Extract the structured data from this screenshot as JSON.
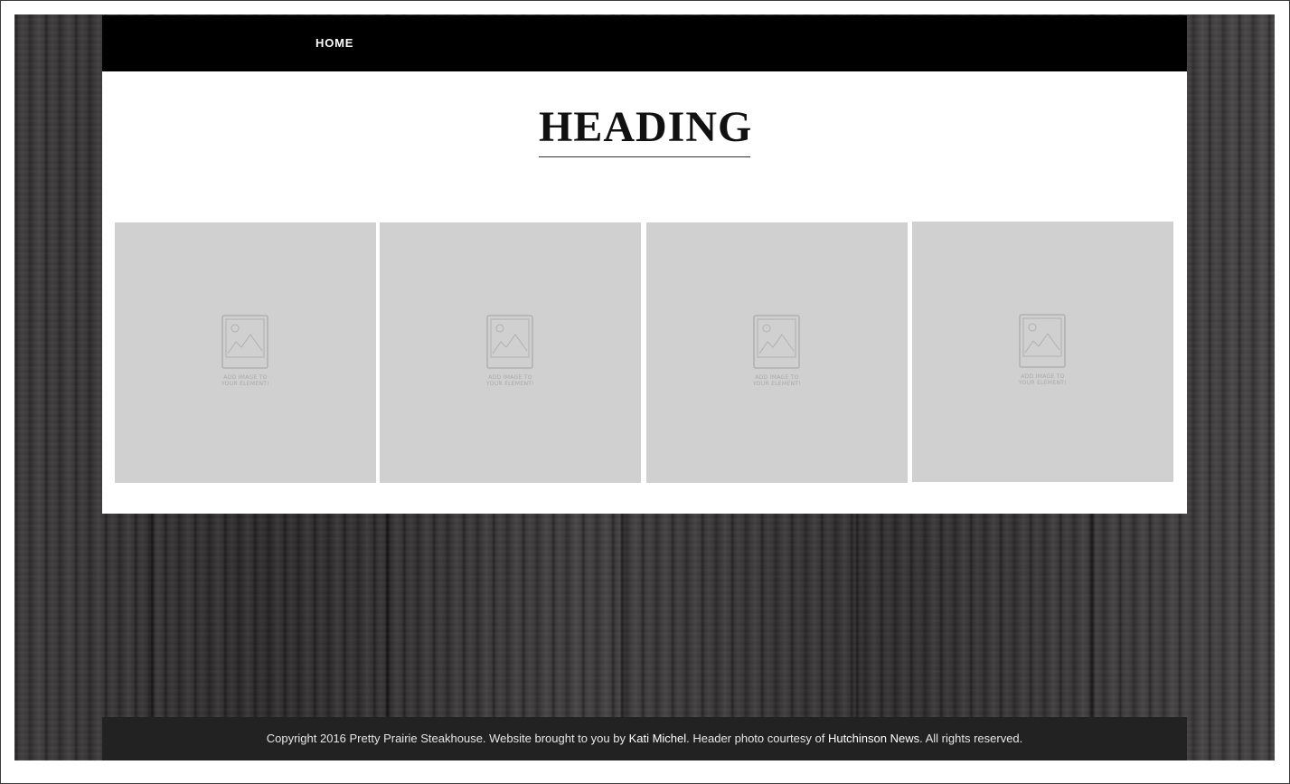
{
  "nav": {
    "home_label": "HOME"
  },
  "main": {
    "heading": "HEADING"
  },
  "gallery": {
    "items": [
      {
        "placeholder_line1": "ADD IMAGE TO",
        "placeholder_line2": "YOUR ELEMENT!"
      },
      {
        "placeholder_line1": "ADD IMAGE TO",
        "placeholder_line2": "YOUR ELEMENT!"
      },
      {
        "placeholder_line1": "ADD IMAGE TO",
        "placeholder_line2": "YOUR ELEMENT!"
      },
      {
        "placeholder_line1": "ADD IMAGE TO",
        "placeholder_line2": "YOUR ELEMENT!"
      }
    ],
    "icon": "image-placeholder-icon",
    "tile_color": "#d0d0d0"
  },
  "footer": {
    "text_before": "Copyright 2016 Pretty Prairie Steakhouse. Website brought to you by ",
    "link1": "Kati Michel",
    "text_middle": ". Header photo courtesy of ",
    "link2": "Hutchinson News",
    "text_after": ". All rights reserved."
  },
  "colors": {
    "navbar": "#000000",
    "footer": "#222222",
    "background_wood": "#3a3839"
  }
}
